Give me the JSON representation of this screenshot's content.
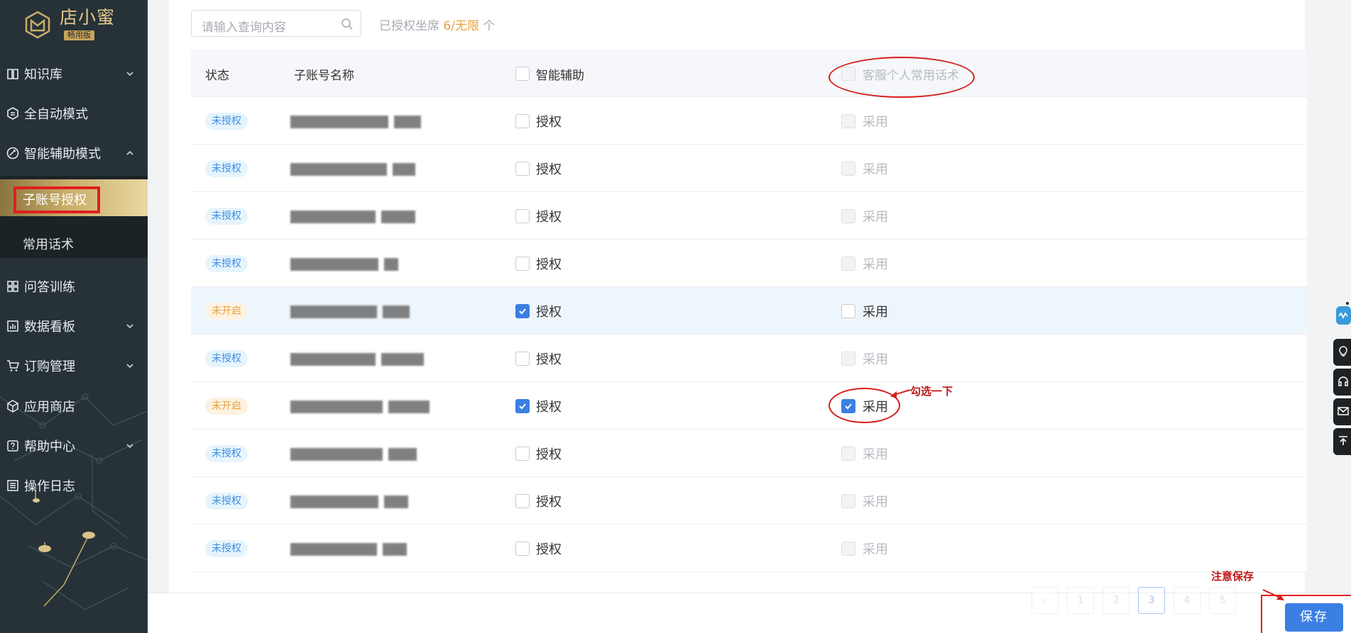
{
  "app": {
    "logo_text": "店小蜜",
    "logo_badge": "畅用版"
  },
  "sidebar": {
    "items": [
      {
        "label": "知识库",
        "icon": "book-icon",
        "expandable": true
      },
      {
        "label": "全自动模式",
        "icon": "robot-icon",
        "expandable": false
      },
      {
        "label": "智能辅助模式",
        "icon": "assist-icon",
        "expandable": true,
        "expanded": true
      },
      {
        "label": "问答训练",
        "icon": "apps-icon",
        "expandable": false
      },
      {
        "label": "数据看板",
        "icon": "chart-icon",
        "expandable": true
      },
      {
        "label": "订购管理",
        "icon": "cart-icon",
        "expandable": true
      },
      {
        "label": "应用商店",
        "icon": "cube-icon",
        "expandable": false
      },
      {
        "label": "帮助中心",
        "icon": "help-icon",
        "expandable": true
      },
      {
        "label": "操作日志",
        "icon": "log-icon",
        "expandable": false
      }
    ],
    "subitems": [
      {
        "label": "子账号授权",
        "active": true
      },
      {
        "label": "常用话术",
        "active": false
      }
    ]
  },
  "toolbar": {
    "search_placeholder": "请输入查询内容",
    "seats_prefix": "已授权坐席",
    "seats_value": "6/无限",
    "seats_suffix": "个"
  },
  "table": {
    "headers": {
      "status": "状态",
      "name": "子账号名称",
      "assist": "智能辅助",
      "personal_phrases": "客服个人常用话术"
    },
    "rows": [
      {
        "status": "未授权",
        "status_color": "blue",
        "auth_label": "授权",
        "auth_checked": false,
        "adopt_label": "采用",
        "adopt_checked": false,
        "adopt_enabled": false
      },
      {
        "status": "未授权",
        "status_color": "blue",
        "auth_label": "授权",
        "auth_checked": false,
        "adopt_label": "采用",
        "adopt_checked": false,
        "adopt_enabled": false
      },
      {
        "status": "未授权",
        "status_color": "blue",
        "auth_label": "授权",
        "auth_checked": false,
        "adopt_label": "采用",
        "adopt_checked": false,
        "adopt_enabled": false
      },
      {
        "status": "未授权",
        "status_color": "blue",
        "auth_label": "授权",
        "auth_checked": false,
        "adopt_label": "采用",
        "adopt_checked": false,
        "adopt_enabled": false
      },
      {
        "status": "未开启",
        "status_color": "orange",
        "auth_label": "授权",
        "auth_checked": true,
        "adopt_label": "采用",
        "adopt_checked": false,
        "adopt_enabled": true
      },
      {
        "status": "未授权",
        "status_color": "blue",
        "auth_label": "授权",
        "auth_checked": false,
        "adopt_label": "采用",
        "adopt_checked": false,
        "adopt_enabled": false
      },
      {
        "status": "未开启",
        "status_color": "orange",
        "auth_label": "授权",
        "auth_checked": true,
        "adopt_label": "采用",
        "adopt_checked": true,
        "adopt_enabled": true
      },
      {
        "status": "未授权",
        "status_color": "blue",
        "auth_label": "授权",
        "auth_checked": false,
        "adopt_label": "采用",
        "adopt_checked": false,
        "adopt_enabled": false
      },
      {
        "status": "未授权",
        "status_color": "blue",
        "auth_label": "授权",
        "auth_checked": false,
        "adopt_label": "采用",
        "adopt_checked": false,
        "adopt_enabled": false
      },
      {
        "status": "未授权",
        "status_color": "blue",
        "auth_label": "授权",
        "auth_checked": false,
        "adopt_label": "采用",
        "adopt_checked": false,
        "adopt_enabled": false
      }
    ]
  },
  "pagination": {
    "prev": "‹",
    "pages": [
      "1",
      "2",
      "3",
      "4",
      "5"
    ],
    "current": "3"
  },
  "footer": {
    "save_label": "保存"
  },
  "annotations": {
    "check_note": "勾选一下",
    "save_note": "注意保存"
  },
  "colors": {
    "sidebar_bg": "#263238",
    "accent_gold": "#c9ad69",
    "primary_blue": "#3b7fe3",
    "annotation_red": "#d81c1c"
  }
}
